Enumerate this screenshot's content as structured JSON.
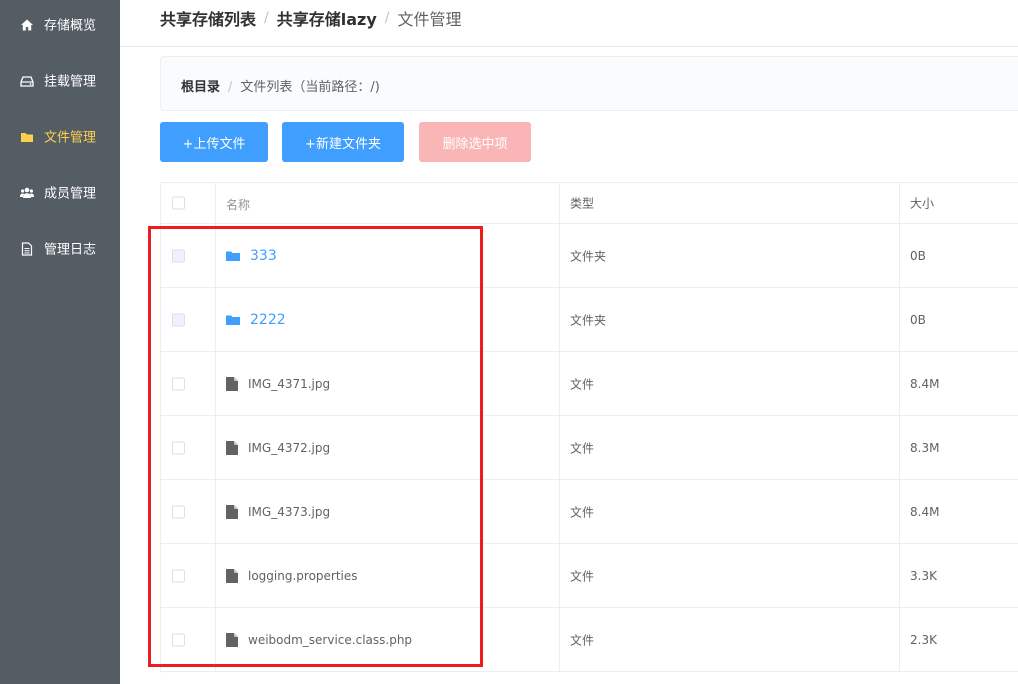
{
  "sidebar": {
    "items": [
      {
        "label": "存储概览",
        "icon": "home-icon",
        "active": false
      },
      {
        "label": "挂载管理",
        "icon": "drive-icon",
        "active": false
      },
      {
        "label": "文件管理",
        "icon": "folder-icon",
        "active": true
      },
      {
        "label": "成员管理",
        "icon": "users-icon",
        "active": false
      },
      {
        "label": "管理日志",
        "icon": "document-icon",
        "active": false
      }
    ],
    "colors": {
      "background": "#545c64",
      "text": "#ffffff",
      "active_text": "#ffd04b"
    }
  },
  "header": {
    "crumb1": "共享存储列表",
    "crumb2": "共享存储lazy",
    "crumb3": "文件管理",
    "separator": "/"
  },
  "path": {
    "root": "根目录",
    "separator": "/",
    "current": "文件列表（当前路径：/)"
  },
  "toolbar": {
    "upload_label": "+上传文件",
    "new_folder_label": "+新建文件夹",
    "delete_label": "删除选中项",
    "colors": {
      "primary": "#409eff",
      "danger_disabled": "#fab6b6"
    }
  },
  "table": {
    "headers": {
      "name": "名称",
      "type": "类型",
      "size": "大小"
    },
    "rows": [
      {
        "name": "333",
        "type": "文件夹",
        "size": "0B",
        "kind": "folder-icon",
        "checkbox_disabled": true
      },
      {
        "name": "2222",
        "type": "文件夹",
        "size": "0B",
        "kind": "folder-icon",
        "checkbox_disabled": true
      },
      {
        "name": "IMG_4371.jpg",
        "type": "文件",
        "size": "8.4M",
        "kind": "file-icon",
        "checkbox_disabled": false
      },
      {
        "name": "IMG_4372.jpg",
        "type": "文件",
        "size": "8.3M",
        "kind": "file-icon",
        "checkbox_disabled": false
      },
      {
        "name": "IMG_4373.jpg",
        "type": "文件",
        "size": "8.4M",
        "kind": "file-icon",
        "checkbox_disabled": false
      },
      {
        "name": "logging.properties",
        "type": "文件",
        "size": "3.3K",
        "kind": "file-icon",
        "checkbox_disabled": false
      },
      {
        "name": "weibodm_service.class.php",
        "type": "文件",
        "size": "2.3K",
        "kind": "file-icon",
        "checkbox_disabled": false
      }
    ]
  },
  "annotation": {
    "color": "#ee1d1d"
  }
}
